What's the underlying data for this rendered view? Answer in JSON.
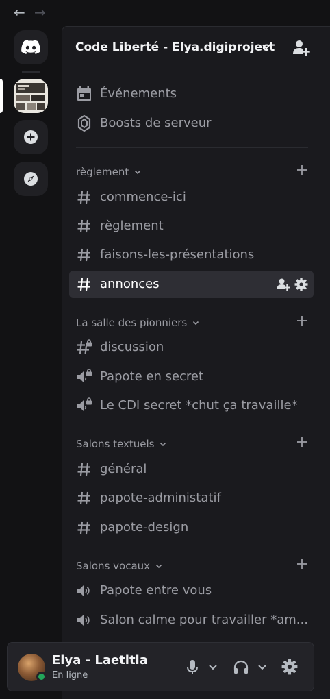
{
  "nav": {
    "back": "←",
    "forward": "→"
  },
  "server": {
    "name": "Code Liberté - Elya.digiproject"
  },
  "top_items": [
    {
      "label": "Événements",
      "icon": "calendar-icon"
    },
    {
      "label": "Boosts de serveur",
      "icon": "boost-gem-icon"
    }
  ],
  "categories": [
    {
      "label": "règlement",
      "channels": [
        {
          "label": "commence-ici",
          "icon": "hash-icon"
        },
        {
          "label": "règlement",
          "icon": "hash-icon"
        },
        {
          "label": "faisons-les-présentations",
          "icon": "hash-icon"
        },
        {
          "label": "annonces",
          "icon": "hash-icon",
          "active": true
        }
      ]
    },
    {
      "label": "La salle des pionniers",
      "channels": [
        {
          "label": "discussion",
          "icon": "locked-hash-icon"
        },
        {
          "label": "Papote en secret",
          "icon": "locked-voice-icon"
        },
        {
          "label": "Le CDI secret *chut ça travaille*",
          "icon": "locked-voice-icon"
        }
      ]
    },
    {
      "label": "Salons textuels",
      "channels": [
        {
          "label": "général",
          "icon": "hash-icon"
        },
        {
          "label": "papote-administatif",
          "icon": "hash-icon"
        },
        {
          "label": "papote-design",
          "icon": "hash-icon"
        }
      ]
    },
    {
      "label": "Salons vocaux",
      "channels": [
        {
          "label": "Papote entre vous",
          "icon": "voice-icon"
        },
        {
          "label": "Salon calme pour travailler *am...",
          "icon": "voice-icon"
        }
      ]
    }
  ],
  "user": {
    "name": "Elya - Laetitia",
    "status": "En ligne"
  },
  "colors": {
    "online": "#23a55a",
    "active_bg": "#2e2e34",
    "panel_bg": "#1a1a1e"
  }
}
